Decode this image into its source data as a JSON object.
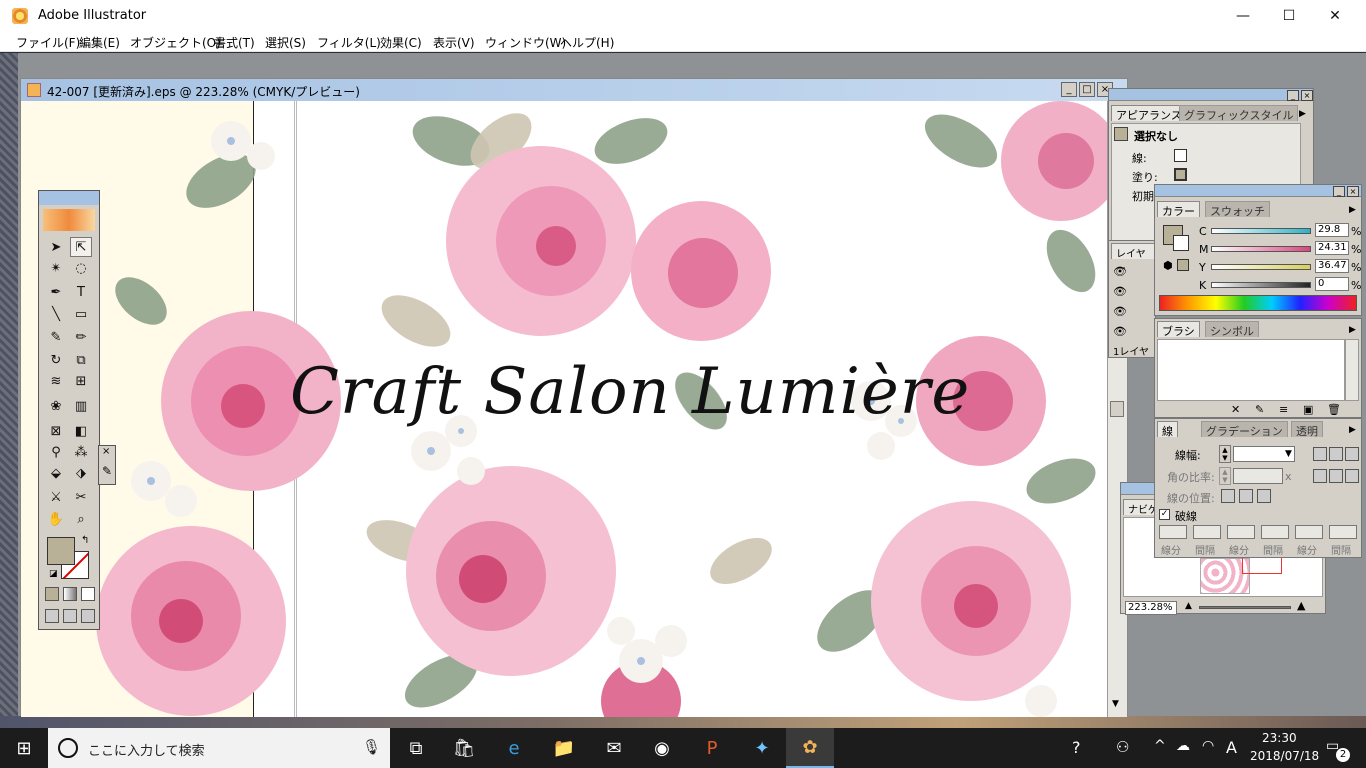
{
  "window": {
    "app_title": "Adobe Illustrator",
    "minimize": "—",
    "maximize": "☐",
    "close": "✕"
  },
  "menu": [
    "ファイル(F)",
    "編集(E)",
    "オブジェクト(O)",
    "書式(T)",
    "選択(S)",
    "フィルタ(L)",
    "効果(C)",
    "表示(V)",
    "ウィンドウ(W)",
    "ヘルプ(H)"
  ],
  "document": {
    "title": "42-007 [更新済み].eps @ 223.28% (CMYK/プレビュー)",
    "artwork_text": "Craft Salon Lumière"
  },
  "appearance_panel": {
    "tabs": [
      "アピアランス",
      "グラフィックスタイル"
    ],
    "selection": "選択なし",
    "stroke_label": "線:",
    "fill_label": "塗り:",
    "default_label": "初期"
  },
  "layers_panel": {
    "tab": "レイヤー",
    "count_label": "1レイヤ"
  },
  "color_panel": {
    "tabs": [
      "カラー",
      "スウォッチ"
    ],
    "channels": [
      {
        "label": "C",
        "value": "29.8",
        "unit": "%",
        "color": "#2bb3c7"
      },
      {
        "label": "M",
        "value": "24.31",
        "unit": "%",
        "color": "#d9467e"
      },
      {
        "label": "Y",
        "value": "36.47",
        "unit": "%",
        "color": "#d8cf5a"
      },
      {
        "label": "K",
        "value": "0",
        "unit": "%",
        "color": "#222222"
      }
    ],
    "fill_color": "#b8b198"
  },
  "brush_panel": {
    "tabs": [
      "ブラシ",
      "シンボル"
    ]
  },
  "stroke_panel": {
    "tabs": [
      "線",
      "グラデーション",
      "透明"
    ],
    "weight_label": "線幅:",
    "miter_label": "角の比率:",
    "miter_unit": "x",
    "align_label": "線の位置:",
    "dashed_label": "破線",
    "dash_fields": [
      "線分",
      "間隔",
      "線分",
      "間隔",
      "線分",
      "間隔"
    ]
  },
  "navigator_panel": {
    "tab": "ナビゲーター",
    "zoom": "223.28%"
  },
  "taskbar": {
    "search_placeholder": "ここに入力して検索",
    "time": "23:30",
    "date": "2018/07/18",
    "ime": "A",
    "notification_count": "2"
  }
}
